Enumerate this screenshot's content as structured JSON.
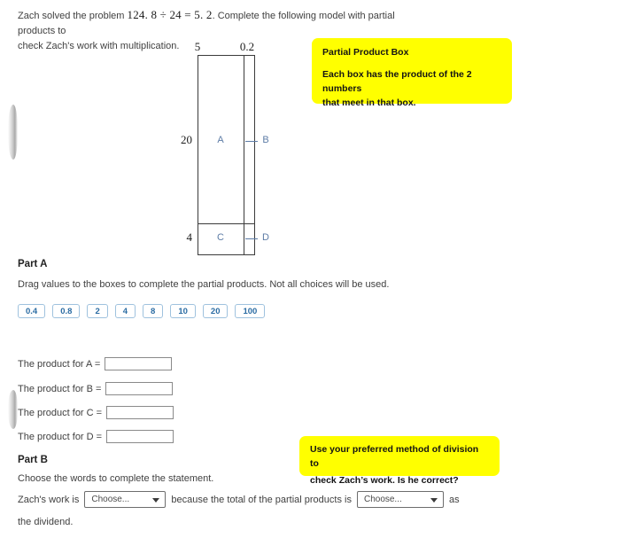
{
  "intro": {
    "line1_before": "Zach solved the problem ",
    "expression": "124. 8 ÷ 24 = 5. 2",
    "line1_after": ". Complete the following model with partial products to",
    "line2": "check Zach's work with multiplication."
  },
  "diagram": {
    "top_dims": [
      {
        "label": "5"
      },
      {
        "label": "0.2"
      }
    ],
    "left_dims": [
      {
        "label": "20"
      },
      {
        "label": "4"
      }
    ],
    "cells": [
      {
        "label": "A"
      },
      {
        "label": "B"
      },
      {
        "label": "C"
      },
      {
        "label": "D"
      }
    ],
    "colors": {
      "cell_label": "#5d7ca6",
      "border": "#3b3b3b"
    }
  },
  "callouts": {
    "top": {
      "title": "Partial Product Box",
      "body_line1": "Each box has the product of the 2 numbers",
      "body_line2": "that meet in that box.",
      "color": "#ffff00"
    },
    "bottom": {
      "line1": "Use your preferred method of division to",
      "line2": "check Zach’s work.  Is he correct?",
      "color": "#ffff00"
    }
  },
  "part_a": {
    "heading": "Part A",
    "instruction": "Drag values to the boxes to complete the partial products. Not all choices will be used.",
    "choices": [
      "0.4",
      "0.8",
      "2",
      "4",
      "8",
      "10",
      "20",
      "100"
    ],
    "choice_color": "#2b6ca3",
    "products": [
      {
        "label": "The product for A =",
        "value": ""
      },
      {
        "label": "The product for B =",
        "value": ""
      },
      {
        "label": "The product for C =",
        "value": ""
      },
      {
        "label": "The product for D =",
        "value": ""
      }
    ]
  },
  "part_b": {
    "heading": "Part B",
    "instruction": "Choose the words to complete the statement.",
    "statement": {
      "before": "Zach's work is",
      "select1_value": "Choose...",
      "middle": "because the total of the partial products is",
      "select2_value": "Choose...",
      "after": "as",
      "tail": "the dividend."
    }
  }
}
